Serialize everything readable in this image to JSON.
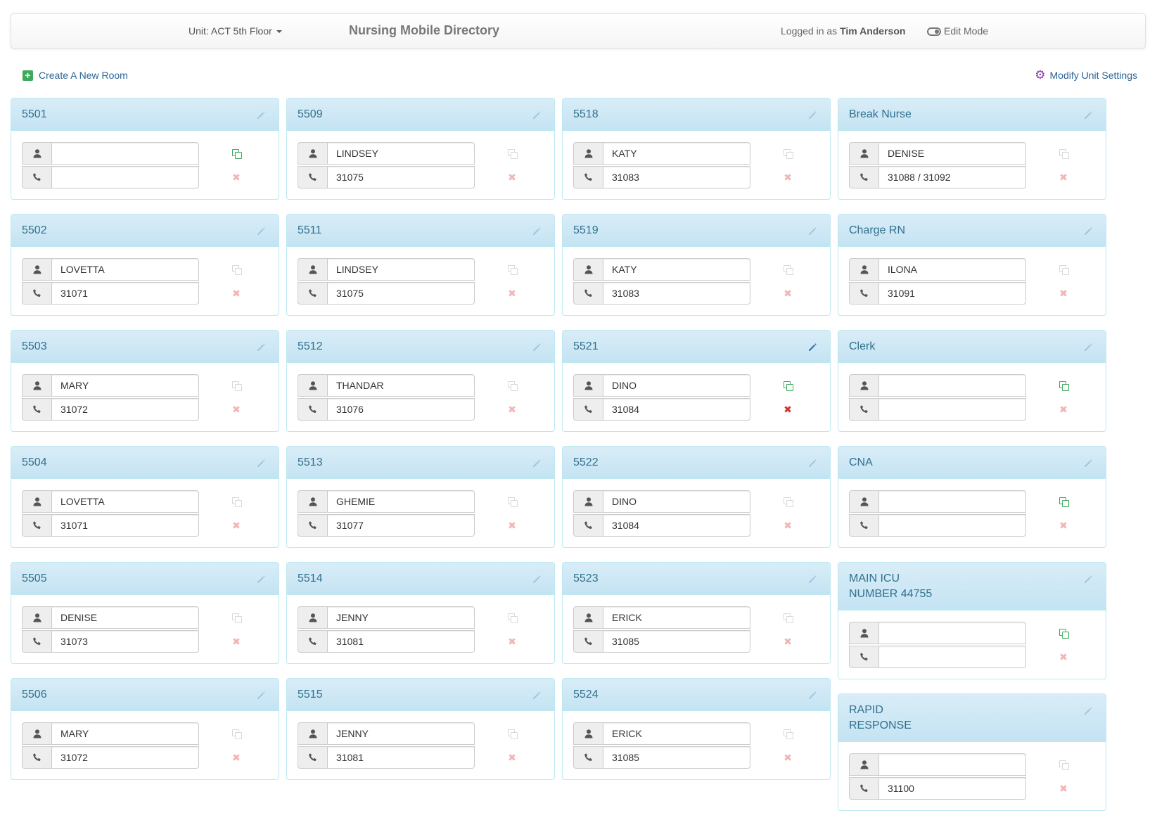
{
  "navbar": {
    "unit_label": "Unit: ACT 5th Floor",
    "brand": "Nursing Mobile Directory",
    "logged_in_prefix": "Logged in as",
    "user_name": "Tim Anderson",
    "edit_mode_label": "Edit Mode"
  },
  "actions": {
    "create_room": "Create A New Room",
    "modify_settings": "Modify Unit Settings"
  },
  "columns": [
    {
      "rooms": [
        {
          "title": "5501",
          "name": "",
          "phone": "",
          "copy": "green",
          "remove": "faint",
          "edit": "faint"
        },
        {
          "title": "5502",
          "name": "LOVETTA",
          "phone": "31071",
          "copy": "faint",
          "remove": "faint",
          "edit": "faint"
        },
        {
          "title": "5503",
          "name": "MARY",
          "phone": "31072",
          "copy": "faint",
          "remove": "faint",
          "edit": "faint"
        },
        {
          "title": "5504",
          "name": "LOVETTA",
          "phone": " 31071",
          "copy": "faint",
          "remove": "faint",
          "edit": "faint"
        },
        {
          "title": "5505",
          "name": "DENISE",
          "phone": "31073",
          "copy": "faint",
          "remove": "faint",
          "edit": "faint"
        },
        {
          "title": "5506",
          "name": "MARY",
          "phone": "31072",
          "copy": "faint",
          "remove": "faint",
          "edit": "faint"
        }
      ]
    },
    {
      "rooms": [
        {
          "title": "5509",
          "name": "LINDSEY",
          "phone": "31075",
          "copy": "faint",
          "remove": "faint",
          "edit": "faint"
        },
        {
          "title": "5511",
          "name": "LINDSEY",
          "phone": "31075",
          "copy": "faint",
          "remove": "faint",
          "edit": "faint"
        },
        {
          "title": "5512",
          "name": "THANDAR",
          "phone": "31076",
          "copy": "faint",
          "remove": "faint",
          "edit": "faint"
        },
        {
          "title": "5513",
          "name": "GHEMIE",
          "phone": "31077",
          "copy": "faint",
          "remove": "faint",
          "edit": "faint"
        },
        {
          "title": "5514",
          "name": "JENNY",
          "phone": "31081",
          "copy": "faint",
          "remove": "faint",
          "edit": "faint"
        },
        {
          "title": "5515",
          "name": "JENNY",
          "phone": "31081",
          "copy": "faint",
          "remove": "faint",
          "edit": "faint"
        }
      ]
    },
    {
      "rooms": [
        {
          "title": "5518",
          "name": "KATY",
          "phone": "31083",
          "copy": "faint",
          "remove": "faint",
          "edit": "faint"
        },
        {
          "title": "5519",
          "name": "KATY",
          "phone": "31083",
          "copy": "faint",
          "remove": "faint",
          "edit": "faint"
        },
        {
          "title": "5521",
          "name": "DINO",
          "phone": "31084",
          "copy": "green",
          "remove": "red",
          "edit": "blue"
        },
        {
          "title": "5522",
          "name": "DINO",
          "phone": "31084",
          "copy": "faint",
          "remove": "faint",
          "edit": "faint"
        },
        {
          "title": "5523",
          "name": "ERICK",
          "phone": "31085",
          "copy": "faint",
          "remove": "faint",
          "edit": "faint"
        },
        {
          "title": "5524",
          "name": "ERICK",
          "phone": "31085",
          "copy": "faint",
          "remove": "faint",
          "edit": "faint"
        }
      ]
    },
    {
      "rooms": [
        {
          "title": "Break Nurse",
          "name": "DENISE",
          "phone": "31088 / 31092",
          "copy": "faint",
          "remove": "faint",
          "edit": "faint"
        },
        {
          "title": "Charge RN",
          "name": "ILONA",
          "phone": "31091",
          "copy": "faint",
          "remove": "faint",
          "edit": "faint"
        },
        {
          "title": "Clerk",
          "name": "",
          "phone": "",
          "copy": "green",
          "remove": "faint",
          "edit": "faint"
        },
        {
          "title": "CNA",
          "name": "",
          "phone": "",
          "copy": "green",
          "remove": "faint",
          "edit": "faint"
        },
        {
          "title": "MAIN ICU\nNUMBER 44755",
          "name": "",
          "phone": "",
          "copy": "green",
          "remove": "faint",
          "edit": "faint"
        },
        {
          "title": "RAPID\nRESPONSE",
          "name": "",
          "phone": "31100",
          "copy": "faint",
          "remove": "faint",
          "edit": "faint"
        }
      ]
    }
  ],
  "colors": {
    "panel_border": "#bce8f1",
    "panel_heading": "#d9edf7",
    "heading_text": "#31708f",
    "copy_active": "#3cab5b",
    "remove_active": "#d9302c",
    "settings_gear": "#8a3ba8"
  }
}
